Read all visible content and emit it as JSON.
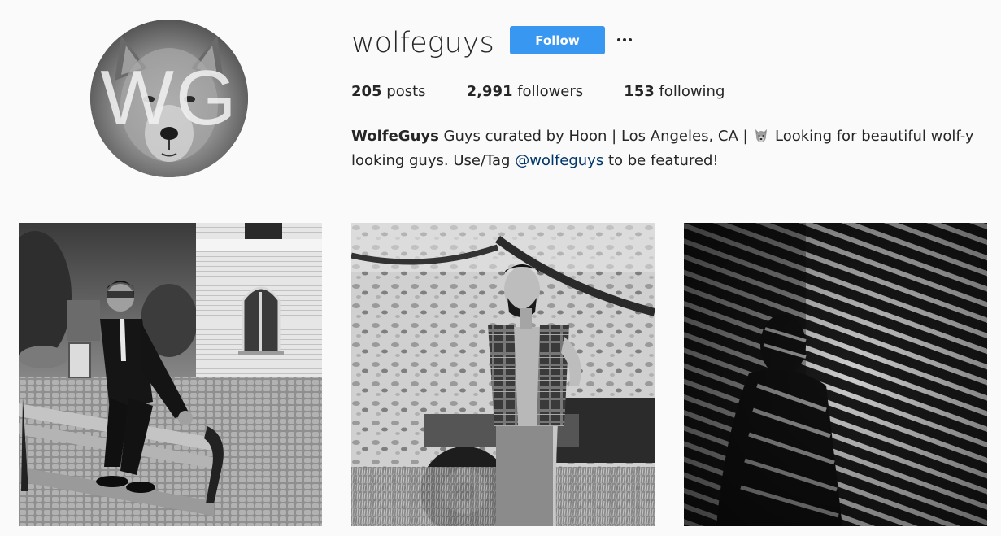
{
  "profile": {
    "username": "wolfeguys",
    "avatar_initials": "WG",
    "follow_label": "Follow",
    "more_icon": "ellipsis-icon",
    "stats": {
      "posts_count": "205",
      "posts_label": " posts",
      "followers_count": "2,991",
      "followers_label": " followers",
      "following_count": "153",
      "following_label": " following"
    },
    "bio": {
      "name": "WolfeGuys",
      "text_part1": " Guys curated by Hoon | Los Angeles, CA | ",
      "emoji": "wolf-icon",
      "text_part2": " Looking for beautiful wolf-y looking guys. Use/Tag ",
      "mention": "@wolfeguys",
      "text_part3": " to be featured!"
    }
  },
  "colors": {
    "follow_button": "#3897f0",
    "mention": "#003569",
    "background": "#fafafa",
    "text": "#262626"
  },
  "posts": [
    {
      "name": "post-man-on-bench"
    },
    {
      "name": "post-man-in-plaid-vest"
    },
    {
      "name": "post-man-in-striped-shadows"
    }
  ]
}
